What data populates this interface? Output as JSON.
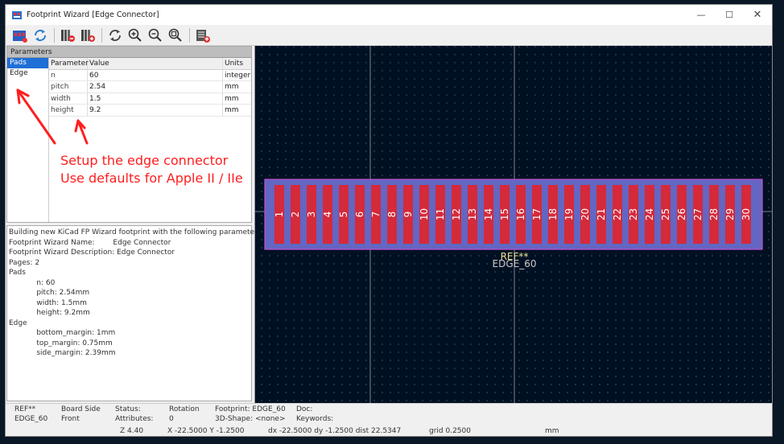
{
  "window": {
    "title": "Footprint Wizard [Edge Connector]"
  },
  "panel": {
    "header": "Parameters",
    "pages": [
      {
        "label": "Pads"
      },
      {
        "label": "Edge"
      }
    ],
    "columns": {
      "param": "Parameter",
      "value": "Value",
      "units": "Units"
    },
    "rows": [
      {
        "param": "n",
        "value": "60",
        "units": "integer"
      },
      {
        "param": "pitch",
        "value": "2.54",
        "units": "mm"
      },
      {
        "param": "width",
        "value": "1.5",
        "units": "mm"
      },
      {
        "param": "height",
        "value": "9.2",
        "units": "mm"
      }
    ]
  },
  "annotation": {
    "line1": "Setup the edge connector",
    "line2": "Use defaults for Apple II / IIe",
    "color": "#ff1e1e"
  },
  "log": {
    "lines": [
      "Building new KiCad FP Wizard footprint with the following parameters:",
      "Footprint Wizard Name:        Edge Connector",
      "Footprint Wizard Description: Edge Connector",
      "Pages: 2",
      "Pads",
      "            n: 60",
      "            pitch: 2.54mm",
      "            width: 1.5mm",
      "            height: 9.2mm",
      "Edge",
      "            bottom_margin: 1mm",
      "            top_margin: 0.75mm",
      "            side_margin: 2.39mm"
    ]
  },
  "footprint": {
    "pads": [
      "1",
      "2",
      "3",
      "4",
      "5",
      "6",
      "7",
      "8",
      "9",
      "10",
      "11",
      "12",
      "13",
      "14",
      "15",
      "16",
      "17",
      "18",
      "19",
      "20",
      "21",
      "22",
      "23",
      "24",
      "25",
      "26",
      "27",
      "28",
      "29",
      "30"
    ],
    "ref": "REF**",
    "value": "EDGE_60",
    "colors": {
      "board": "#6366c2",
      "outline": "#c050d0",
      "pad": "#d42a3a",
      "pad_text": "#ffffff",
      "ref_text": "#e8e090",
      "value_text": "#c8c8c8"
    }
  },
  "status": {
    "ref_label": "REF**",
    "ref_value": "EDGE_60",
    "side_label": "Board Side",
    "side_value": "Front",
    "status_label": "Status:",
    "attr_label": "Attributes:",
    "rotation_label": "Rotation",
    "rotation_value": "0",
    "footprint_label": "Footprint: EDGE_60",
    "shape_label": "3D-Shape: <none>",
    "doc_label": "Doc:",
    "keywords_label": "Keywords:",
    "zoom": "Z 4.40",
    "coords": "X -22.5000  Y -1.2500",
    "delta": "dx -22.5000  dy -1.2500  dist 22.5347",
    "grid": "grid 0.2500",
    "units": "mm"
  },
  "icons": [
    "wizard-select-icon",
    "refresh-icon",
    "export-library-icon",
    "export-board-icon",
    "redraw-icon",
    "zoom-in-icon",
    "zoom-out-icon",
    "zoom-fit-icon",
    "show-footprint-icon"
  ]
}
